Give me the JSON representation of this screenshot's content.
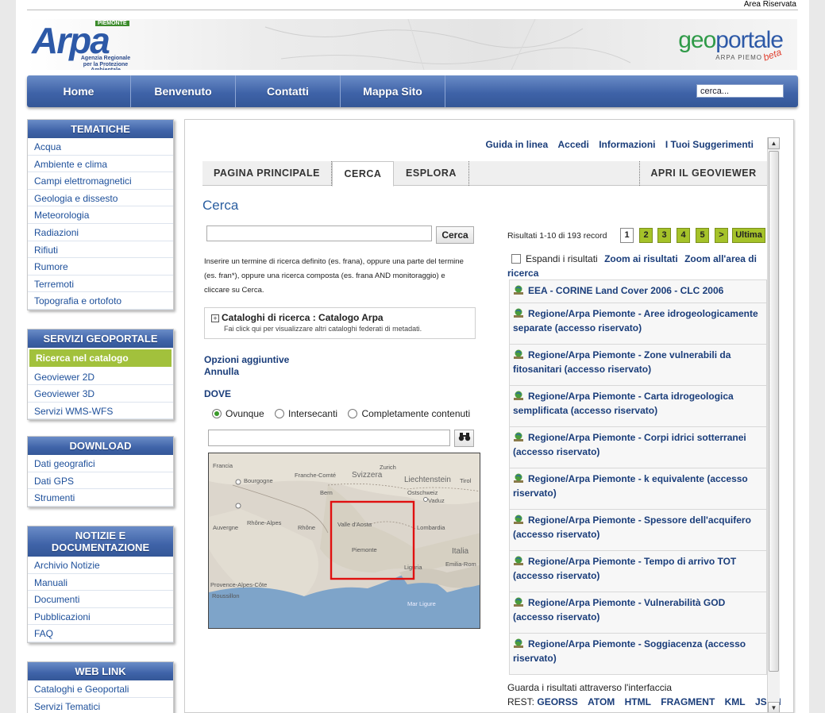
{
  "header": {
    "reserved_area": "Area Riservata",
    "arpa_logo": {
      "word": "Arpa",
      "region": "PIEMONTE",
      "subtitle_line1": "Agenzia Regionale",
      "subtitle_line2": "per la Protezione Ambientale"
    },
    "geoportal_logo": {
      "word_part1": "geo",
      "word_part2": "portale",
      "subtitle": "ARPA PIEMO",
      "badge": "beta"
    }
  },
  "nav": {
    "items": [
      {
        "label": "Home"
      },
      {
        "label": "Benvenuto"
      },
      {
        "label": "Contatti"
      },
      {
        "label": "Mappa Sito"
      }
    ],
    "search_value": "cerca..."
  },
  "sidebar": {
    "tematiche": {
      "title": "TEMATICHE",
      "items": [
        "Acqua",
        "Ambiente e clima",
        "Campi elettromagnetici",
        "Geologia e dissesto",
        "Meteorologia",
        "Radiazioni",
        "Rifiuti",
        "Rumore",
        "Terremoti",
        "Topografia e ortofoto"
      ]
    },
    "servizi": {
      "title": "SERVIZI GEOPORTALE",
      "items": [
        "Ricerca nel catalogo",
        "Geoviewer 2D",
        "Geoviewer 3D",
        "Servizi WMS-WFS"
      ]
    },
    "download": {
      "title": "DOWNLOAD",
      "items": [
        "Dati geografici",
        "Dati GPS",
        "Strumenti"
      ]
    },
    "notizie": {
      "title_line1": "NOTIZIE E",
      "title_line2": "DOCUMENTAZIONE",
      "items": [
        "Archivio Notizie",
        "Manuali",
        "Documenti",
        "Pubblicazioni",
        "FAQ"
      ]
    },
    "weblink": {
      "title": "WEB LINK",
      "items": [
        "Cataloghi e Geoportali",
        "Servizi Tematici"
      ]
    }
  },
  "main": {
    "top_links": [
      "Guida in linea",
      "Accedi",
      "Informazioni",
      "I Tuoi Suggerimenti"
    ],
    "tabs": [
      "PAGINA PRINCIPALE",
      "CERCA",
      "ESPLORA",
      "APRI IL GEOVIEWER"
    ],
    "page_title": "Cerca",
    "search_button": "Cerca",
    "help_text": "Inserire un termine di ricerca definito (es. frana), oppure una parte del termine (es. fran*), oppure una ricerca composta (es. frana AND monitoraggio) e cliccare su Cerca.",
    "catalog": {
      "title": "Cataloghi di ricerca : Catalogo Arpa",
      "subtitle": "Fai click qui per visualizzare altri cataloghi federati di metadati."
    },
    "options_link": "Opzioni aggiuntive",
    "cancel_link": "Annulla",
    "where_label": "DOVE",
    "where_options": [
      "Ovunque",
      "Intersecanti",
      "Completamente contenuti"
    ],
    "where_selected": "Ovunque",
    "map_labels": [
      "Francia",
      "Svizzera",
      "Liechtenstein",
      "Bourgogne",
      "Franche-Comté",
      "Zurich",
      "Tirol",
      "Bern",
      "Ostschweiz",
      "Vaduz",
      "Rhône-Alpes",
      "Valle d'Aosta",
      "Lombardia",
      "Piemonte",
      "Italia",
      "Emilia-Rom",
      "Liguria",
      "Auvergne",
      "Rhône",
      "Provence-Alpes-Côte",
      "Roussillon",
      "Mar Ligure"
    ]
  },
  "results": {
    "info": "Risultati 1-10 di 193 record",
    "pages": [
      "1",
      "2",
      "3",
      "4",
      "5",
      ">",
      "Ultima"
    ],
    "current_page": "1",
    "expand_label": "Espandi i risultati",
    "zoom_results": "Zoom ai risultati",
    "zoom_area_line1": "Zoom all'area di",
    "zoom_area_line2": "ricerca",
    "items": [
      "EEA - CORINE Land Cover 2006 - CLC 2006",
      "Regione/Arpa Piemonte - Aree idrogeologicamente separate (accesso riservato)",
      "Regione/Arpa Piemonte - Zone vulnerabili da fitosanitari (accesso riservato)",
      "Regione/Arpa Piemonte - Carta idrogeologica semplificata (accesso riservato)",
      "Regione/Arpa Piemonte - Corpi idrici sotterranei (accesso riservato)",
      "Regione/Arpa Piemonte - k equivalente (accesso riservato)",
      "Regione/Arpa Piemonte - Spessore dell'acquifero (accesso riservato)",
      "Regione/Arpa Piemonte - Tempo di arrivo TOT (accesso riservato)",
      "Regione/Arpa Piemonte - Vulnerabilità GOD (accesso riservato)",
      "Regione/Arpa Piemonte - Soggiacenza (accesso riservato)"
    ],
    "interface_text": "Guarda i risultati attraverso l'interfaccia",
    "rest_label": "REST:",
    "rest_links": [
      "GEORSS",
      "ATOM",
      "HTML",
      "FRAGMENT",
      "KML",
      "JSON"
    ]
  },
  "colors": {
    "nav_blue": "#3f63a8",
    "link_blue": "#1a3d7a",
    "pager_green": "#a5c229",
    "active_green": "#a2c13c",
    "map_box": "#e01010"
  }
}
